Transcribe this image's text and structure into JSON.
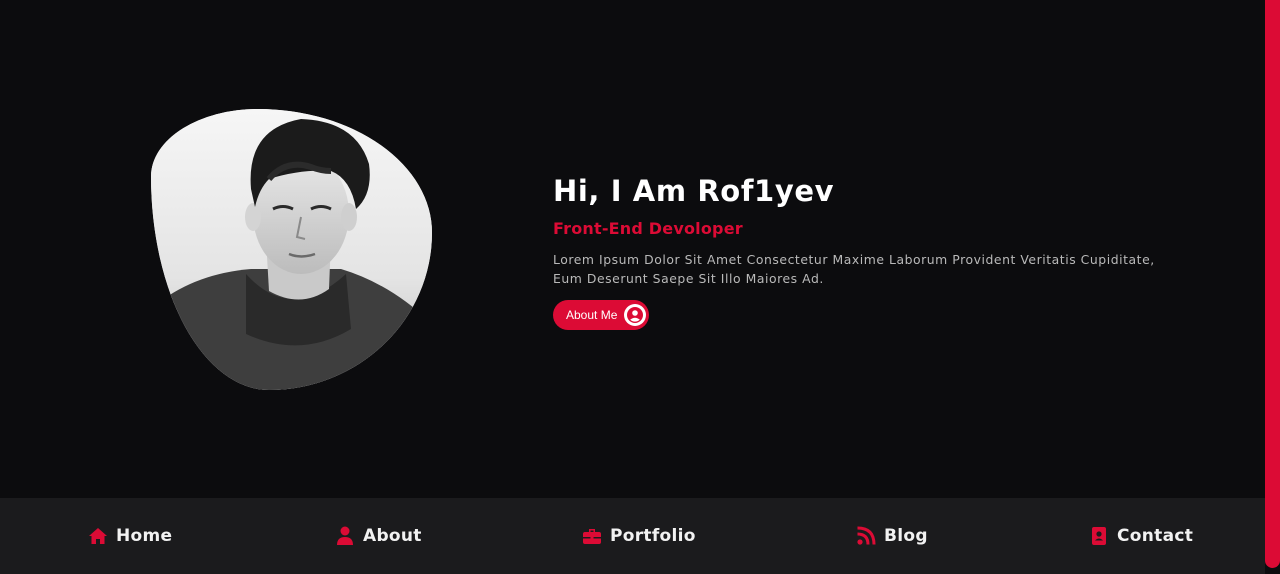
{
  "hero": {
    "greeting": "Hi, I Am Rof1yev",
    "role": "Front-End Devoloper",
    "description": "Lorem Ipsum Dolor Sit Amet Consectetur Maxime Laborum Provident Veritatis Cupiditate, Eum Deserunt Saepe Sit Illo Maiores Ad.",
    "button_label": "About Me",
    "button_icon": "user-circle-icon"
  },
  "nav": {
    "items": [
      {
        "label": "Home",
        "icon": "home-icon"
      },
      {
        "label": "About",
        "icon": "user-icon"
      },
      {
        "label": "Portfolio",
        "icon": "briefcase-icon"
      },
      {
        "label": "Blog",
        "icon": "blog-feed-icon"
      },
      {
        "label": "Contact",
        "icon": "contact-card-icon"
      }
    ]
  },
  "colors": {
    "accent": "#dc0b35",
    "background": "#0c0c0e",
    "nav_background": "#1b1b1d",
    "text": "#ffffff",
    "muted_text": "#b9b9b9"
  }
}
